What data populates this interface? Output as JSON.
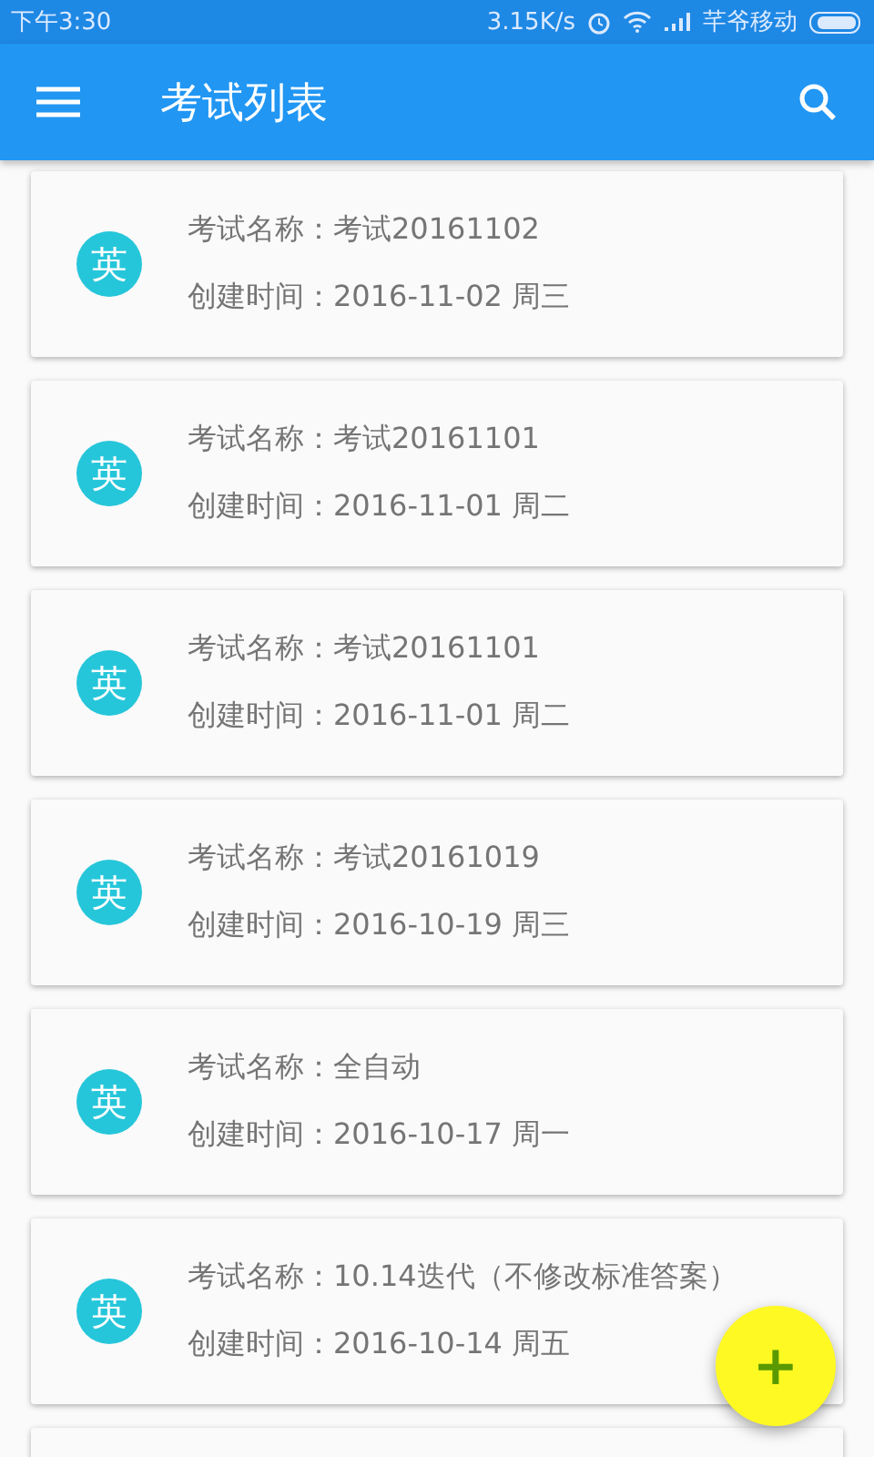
{
  "status_bar": {
    "time": "下午3:30",
    "speed": "3.15K/s",
    "carrier": "芊爷移动"
  },
  "app_bar": {
    "title": "考试列表"
  },
  "exams": [
    {
      "badge": "英",
      "name": "考试名称：考试20161102",
      "created": "创建时间：2016-11-02 周三"
    },
    {
      "badge": "英",
      "name": "考试名称：考试20161101",
      "created": "创建时间：2016-11-01 周二"
    },
    {
      "badge": "英",
      "name": "考试名称：考试20161101",
      "created": "创建时间：2016-11-01 周二"
    },
    {
      "badge": "英",
      "name": "考试名称：考试20161019",
      "created": "创建时间：2016-10-19 周三"
    },
    {
      "badge": "英",
      "name": "考试名称：全自动",
      "created": "创建时间：2016-10-17 周一"
    },
    {
      "badge": "英",
      "name": "考试名称：10.14迭代（不修改标准答案）",
      "created": "创建时间：2016-10-14 周五"
    }
  ],
  "fab": {
    "label": "+"
  }
}
